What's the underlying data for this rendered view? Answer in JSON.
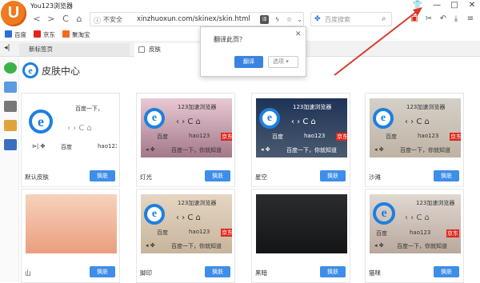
{
  "app": {
    "title": "You123浏览器"
  },
  "window": {
    "minimize": "—",
    "restore": "□",
    "close": "✕"
  },
  "toolbar": {
    "back": "<",
    "forward": ">",
    "refresh": "C",
    "home": "⌂",
    "insecure_label": "不安全",
    "url": "xinzhuoxun.com/skinex/skin.html",
    "search_placeholder": "百度搜索"
  },
  "bookmarks": [
    {
      "label": "百度",
      "color": "#2a6fe0"
    },
    {
      "label": "京东",
      "color": "#e1251b"
    },
    {
      "label": "聚淘宝",
      "color": "#f5691e"
    }
  ],
  "tabs": [
    {
      "label": "新标签页"
    },
    {
      "label": "皮肤"
    }
  ],
  "page": {
    "title": "皮肤中心"
  },
  "popup": {
    "question": "翻译此页？",
    "translate": "翻译",
    "options": "选项"
  },
  "skins": [
    {
      "name": "默认皮肤",
      "button": "换肤",
      "bg": "#ffffff",
      "theme": "light"
    },
    {
      "name": "灯光",
      "button": "换肤",
      "bg": "#d9b8c4",
      "theme": "light"
    },
    {
      "name": "星空",
      "button": "换肤",
      "bg": "#2d3a55",
      "theme": "dark"
    },
    {
      "name": "沙滩",
      "button": "换肤",
      "bg": "#d8cfc4",
      "theme": "light"
    },
    {
      "name": "山",
      "button": "换肤",
      "bg": "#f0b59a",
      "theme": "light"
    },
    {
      "name": "脚印",
      "button": "换肤",
      "bg": "#e0d2bf",
      "theme": "light"
    },
    {
      "name": "黑暗",
      "button": "换肤",
      "bg": "#1e2022",
      "theme": "dark"
    },
    {
      "name": "猫咪",
      "button": "换肤",
      "bg": "#d9cfc8",
      "theme": "light"
    }
  ],
  "preview": {
    "browser_name": "123加速浏览器",
    "baidu": "百度",
    "hao": "hao123",
    "jd": "京东",
    "baidu_search": "百度一下，你就知道",
    "baidu_search_short": "百度一下，"
  },
  "colors": {
    "accent": "#3d8ee8",
    "arrow": "#d93a2e"
  }
}
